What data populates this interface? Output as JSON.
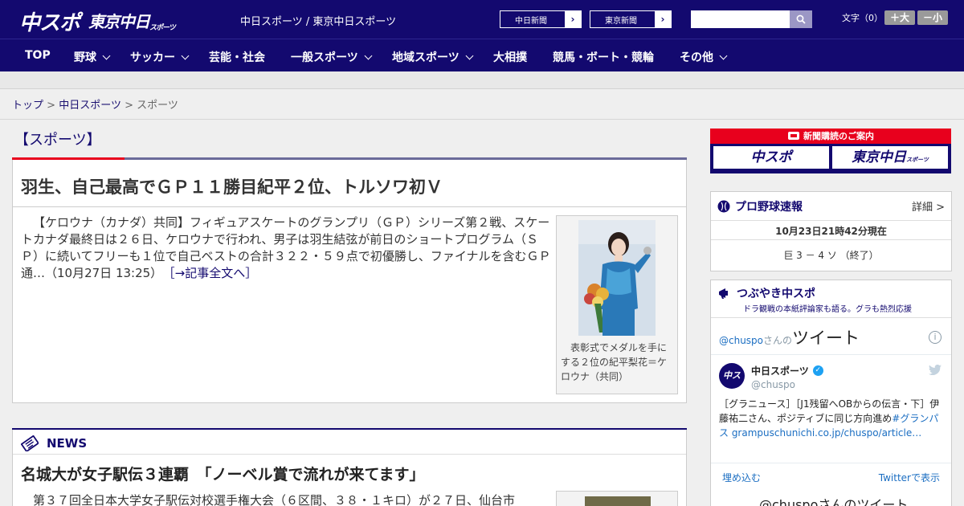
{
  "header": {
    "logo_chuspo": "中スポ",
    "logo_tokyo": "東京中日",
    "logo_tokyo_sub": "スポーツ",
    "tagline": "中日スポーツ / 東京中日スポーツ",
    "links": [
      "中日新聞",
      "東京新聞"
    ],
    "link_arrow": "›",
    "search_placeholder": "",
    "font_size_label": "文字（0）",
    "font_up": "＋大",
    "font_down": "－小"
  },
  "nav": {
    "items": [
      {
        "label": "TOP",
        "dropdown": false
      },
      {
        "label": "野球",
        "dropdown": true
      },
      {
        "label": "サッカー",
        "dropdown": true
      },
      {
        "label": "芸能・社会",
        "dropdown": false
      },
      {
        "label": "一般スポーツ",
        "dropdown": true
      },
      {
        "label": "地域スポーツ",
        "dropdown": true
      },
      {
        "label": "大相撲",
        "dropdown": false
      },
      {
        "label": "競馬・ボート・競輪",
        "dropdown": false
      },
      {
        "label": "その他",
        "dropdown": true
      }
    ]
  },
  "breadcrumb": {
    "items": [
      "トップ",
      "中日スポーツ",
      "スポーツ"
    ],
    "separator": ">"
  },
  "section_title": "【スポーツ】",
  "article": {
    "title": "羽生、自己最高でＧＰ１１勝目紀平２位、トルソワ初Ｖ",
    "body": "【ケロウナ（カナダ）共同】フィギュアスケートのグランプリ（ＧＰ）シリーズ第２戦、スケートカナダ最終日は２６日、ケロウナで行われ、男子は羽生結弦が前日のショートプログラム（ＳＰ）に続いてフリーも１位で自己ベストの合計３２２・５９点で初優勝し、ファイナルを含むＧＰ通…（10月27日 13:25）",
    "read_more": "［→記事全文へ］",
    "photo_caption": "表彰式でメダルを手にする２位の紀平梨花＝ケロウナ（共同）"
  },
  "news": {
    "label": "NEWS",
    "title": "名城大が女子駅伝３連覇　「ノーベル賞で流れが来てます」",
    "body": "第３７回全日本大学女子駅伝対校選手権大会（６区間、３８・１キロ）が２７日、仙台市"
  },
  "sidebar": {
    "subscribe": {
      "label": "新聞購読のご案内",
      "brand1": "中スポ",
      "brand2": "東京中日",
      "brand2_sub": "スポーツ"
    },
    "baseball": {
      "title": "プロ野球速報",
      "detail": "詳細 >",
      "time": "10月23日21時42分現在",
      "score": "巨 3 － 4 ソ （終了）"
    },
    "twitter": {
      "title": "つぶやき中スポ",
      "subtitle": "ドラ観戦の本紙評論家も語る。グラも熱烈応援",
      "handle_prefix": "@chuspo",
      "handle_suffix": "さんの",
      "tweets_label": "ツイート",
      "info_icon": "i",
      "account_name": "中日スポーツ",
      "account_handle": "@chuspo",
      "avatar_text": "中スポ",
      "tweet_text": "［グラニュース］［J1残留へOBからの伝言・下］伊藤祐二さん、ポジティブに同じ方向進め",
      "tweet_link": "#グランパス grampuschunichi.co.jp/chuspo/article…",
      "embed": "埋め込む",
      "view_on_twitter": "Twitterで表示",
      "more": "@chuspoさんのツイート"
    }
  }
}
